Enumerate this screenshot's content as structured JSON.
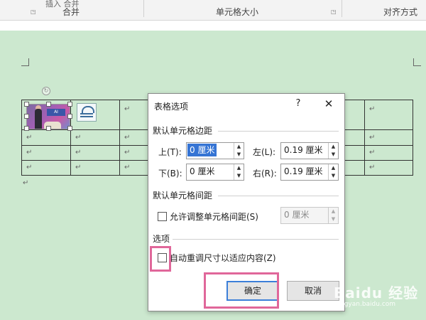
{
  "ribbon": {
    "cutoff_text": "插入  合并",
    "groups": [
      "合并",
      "单元格大小",
      "对齐方式"
    ]
  },
  "document": {
    "para_mark": "↵",
    "photo_caption": "AI"
  },
  "dialog": {
    "title": "表格选项",
    "help": "?",
    "close": "✕",
    "margins_section": "默认单元格边距",
    "top_label": "上(T):",
    "bottom_label": "下(B):",
    "left_label": "左(L):",
    "right_label": "右(R):",
    "top_value": "0 厘米",
    "bottom_value": "0 厘米",
    "left_value": "0.19 厘米",
    "right_value": "0.19 厘米",
    "spacing_section": "默认单元格间距",
    "allow_spacing_label": "允许调整单元格间距(S)",
    "spacing_value": "0 厘米",
    "options_section": "选项",
    "autofit_label": "自动重调尺寸以适应内容(Z)",
    "ok_button": "确定",
    "cancel_button": "取消"
  },
  "watermark": {
    "brand": "Baidu 经验",
    "url": "jingyan.baidu.com"
  },
  "colors": {
    "canvas": "#cce8cf",
    "highlight": "#e0679a",
    "selection": "#3574d4"
  }
}
